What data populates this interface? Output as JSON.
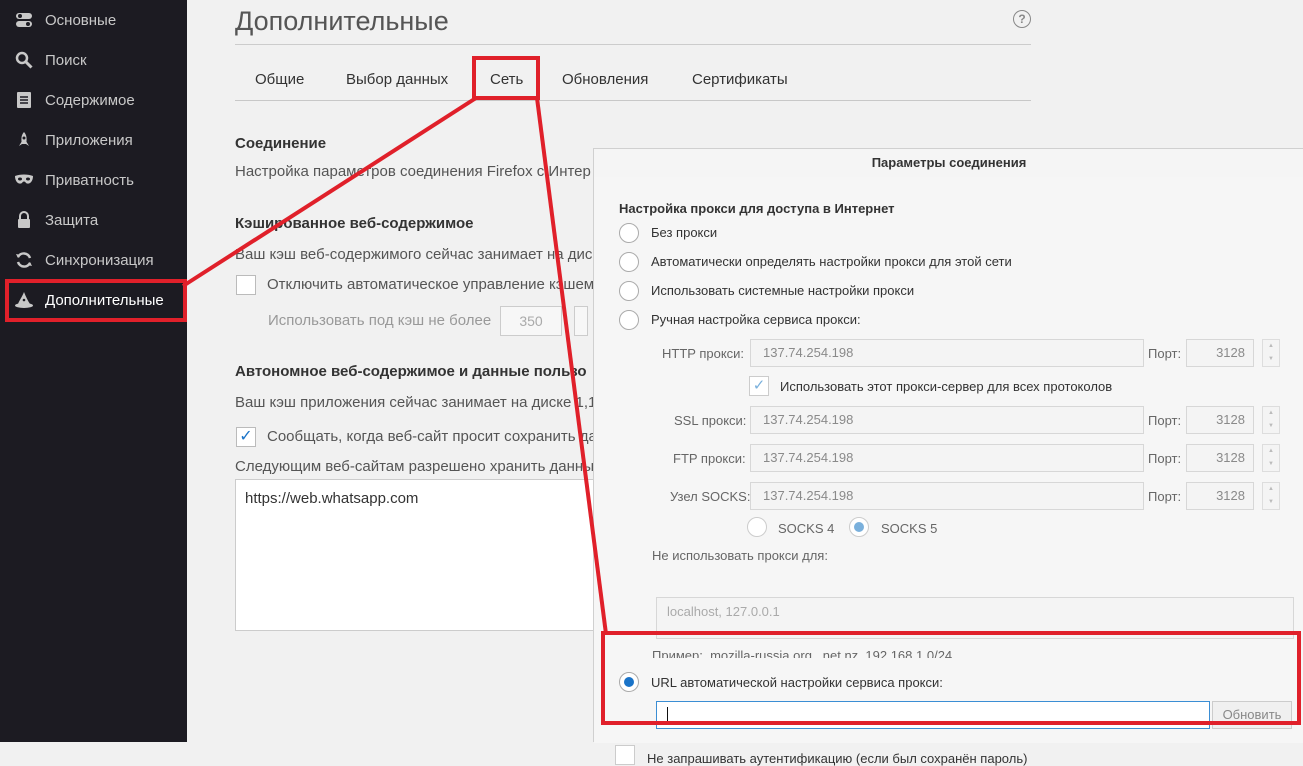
{
  "sidebar": {
    "items": [
      {
        "label": "Основные",
        "icon": "toggles-icon"
      },
      {
        "label": "Поиск",
        "icon": "search-icon"
      },
      {
        "label": "Содержимое",
        "icon": "document-icon"
      },
      {
        "label": "Приложения",
        "icon": "rocket-icon"
      },
      {
        "label": "Приватность",
        "icon": "mask-icon"
      },
      {
        "label": "Защита",
        "icon": "lock-icon"
      },
      {
        "label": "Синхронизация",
        "icon": "sync-icon"
      },
      {
        "label": "Дополнительные",
        "icon": "wizard-hat-icon",
        "selected": true
      }
    ]
  },
  "main": {
    "title": "Дополнительные",
    "help": "?",
    "tabs": [
      "Общие",
      "Выбор данных",
      "Сеть",
      "Обновления",
      "Сертификаты"
    ],
    "active_tab": "Сеть",
    "connection": {
      "heading": "Соединение",
      "desc": "Настройка параметров соединения Firefox с Интер"
    },
    "cache": {
      "heading": "Кэшированное веб-содержимое",
      "desc": "Ваш кэш веб-содержимого сейчас занимает на дис",
      "override_label": "Отключить автоматическое управление кэшем",
      "limit_label": "Использовать под кэш не более",
      "limit_value": "350"
    },
    "offline": {
      "heading": "Автономное веб-содержимое и данные пользо",
      "desc": "Ваш кэш приложения сейчас занимает на диске 1,1",
      "notify_label": "Сообщать, когда веб-сайт просит сохранить да",
      "allowed_label": "Следующим веб-сайтам разрешено хранить данны",
      "sites": [
        "https://web.whatsapp.com"
      ]
    }
  },
  "dialog": {
    "title": "Параметры соединения",
    "heading": "Настройка прокси для доступа в Интернет",
    "options": {
      "no_proxy": "Без прокси",
      "auto_detect": "Автоматически определять настройки прокси для этой сети",
      "system": "Использовать системные настройки прокси",
      "manual": "Ручная настройка сервиса прокси:",
      "pac": "URL автоматической настройки сервиса прокси:"
    },
    "http_label": "HTTP прокси:",
    "http_value": "137.74.254.198",
    "port_label": "Порт:",
    "http_port": "3128",
    "share_label": "Использовать этот прокси-сервер для всех протоколов",
    "ssl_label": "SSL прокси:",
    "ssl_value": "137.74.254.198",
    "ssl_port": "3128",
    "ftp_label": "FTP прокси:",
    "ftp_value": "137.74.254.198",
    "ftp_port": "3128",
    "socks_label": "Узел SOCKS:",
    "socks_value": "137.74.254.198",
    "socks_port": "3128",
    "socks4": "SOCKS 4",
    "socks5": "SOCKS 5",
    "no_proxy_for_label": "Не использовать прокси для:",
    "no_proxy_for_value": "localhost, 127.0.0.1",
    "example": "Пример: .mozilla-russia.org, .net.nz, 192.168.1.0/24",
    "pac_url": "",
    "reload_button": "Обновить",
    "no_auth_label": "Не запрашивать аутентификацию (если был сохранён пароль)"
  },
  "colors": {
    "annotation_red": "#e0202a",
    "accent_blue": "#1a73c8",
    "sidebar_bg": "#1c1b22"
  }
}
